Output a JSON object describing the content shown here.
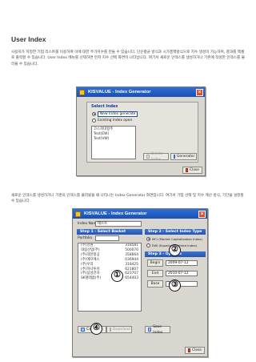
{
  "doc": {
    "title": "User Index",
    "p1": "사용자가 지정한 기업 리스트를 이용하여 이에 대한 주가지수를 만들 수 있습니다. 단순평균 방식과 시가총액방식으로 지수 생성이 가능하며, 결과를 엑셀로 출력할 수 있습니다. User Index 메뉴를 선택하면 먼저 지수 선택 화면이 나타납니다. 여기서 새로운 인덱스를 생성하거나 기존에 작성한 인덱스를 불러올 수 있습니다.",
    "p2": "새로운 인덱스를 생성하거나 기존의 인덱스를 불러왔을 때 나타나는 Index Generator 화면입니다. 여기서 기업 선택 및 지수 계산 방식, 기간을 설정할 수 있습니다."
  },
  "win1": {
    "title": "KISVALUE - Index Generator",
    "group_title": "Select Index",
    "radio_new": "New Index generate",
    "radio_existing": "Existing Index open",
    "list": [
      "코스피대형주",
      "Test(EW)",
      "Test(VW)"
    ],
    "delete_btn": "Delete Index",
    "generate_btn": "Generator",
    "close_btn": "Close"
  },
  "win2": {
    "title": "KISVALUE - Index Generator",
    "index_name_label": "Index Name",
    "index_name_value": "테스트",
    "step1": "Step 1 - Select Basket",
    "portfolio_label": "Portfolio",
    "stocks": [
      {
        "name": "(주)강원",
        "code": "318581"
      },
      {
        "name": "대림산업(주)",
        "code": "500070"
      },
      {
        "name": "(주)대한항공",
        "code": "358664"
      },
      {
        "name": "(주)에프에스",
        "code": "036944"
      },
      {
        "name": "(주)우리",
        "code": "318425"
      },
      {
        "name": "(주)하나투어",
        "code": "621807"
      },
      {
        "name": "(주)삼성전자",
        "code": "623707"
      },
      {
        "name": "SK텔레콤(주)",
        "code": "654403"
      }
    ],
    "step2": "Step 2 - Select Index Type",
    "type_mci": "MCI (Market Capitalization Index)",
    "type_ewi": "EWI (Equally Weighted Index)",
    "step3": "Step 3 - Options",
    "begin_label": "Begin",
    "begin_value": "2009-07-12",
    "end_label": "End",
    "end_value": "2010-07-12",
    "base_label": "Base",
    "base_value": "100",
    "calc_btn": "Calculate",
    "download_btn": "Download",
    "save_btn": "Save Index",
    "close_btn": "Close",
    "markers": [
      "①",
      "②",
      "③",
      "④"
    ]
  }
}
